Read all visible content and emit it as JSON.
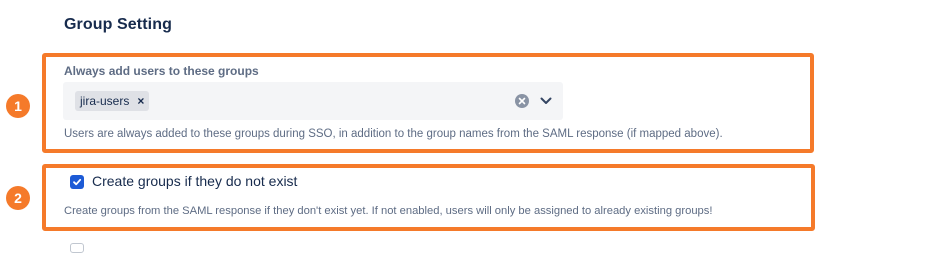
{
  "section": {
    "title": "Group Setting"
  },
  "badges": [
    "1",
    "2"
  ],
  "group_field": {
    "label": "Always add users to these groups",
    "selected_tags": [
      {
        "label": "jira-users",
        "remove": "×"
      }
    ],
    "helper": "Users are always added to these groups during SSO, in addition to the group names from the SAML response (if mapped above)."
  },
  "create_groups": {
    "checked": true,
    "label": "Create groups if they do not exist",
    "helper": "Create groups from the SAML response if they don't exist yet. If not enabled, users will only be assigned to already existing groups!"
  },
  "colors": {
    "highlight": "#f57a2a",
    "checkbox": "#1d5bd6",
    "text_primary": "#172b4d",
    "text_secondary": "#5e6c84",
    "field_bg": "#f4f5f7"
  }
}
